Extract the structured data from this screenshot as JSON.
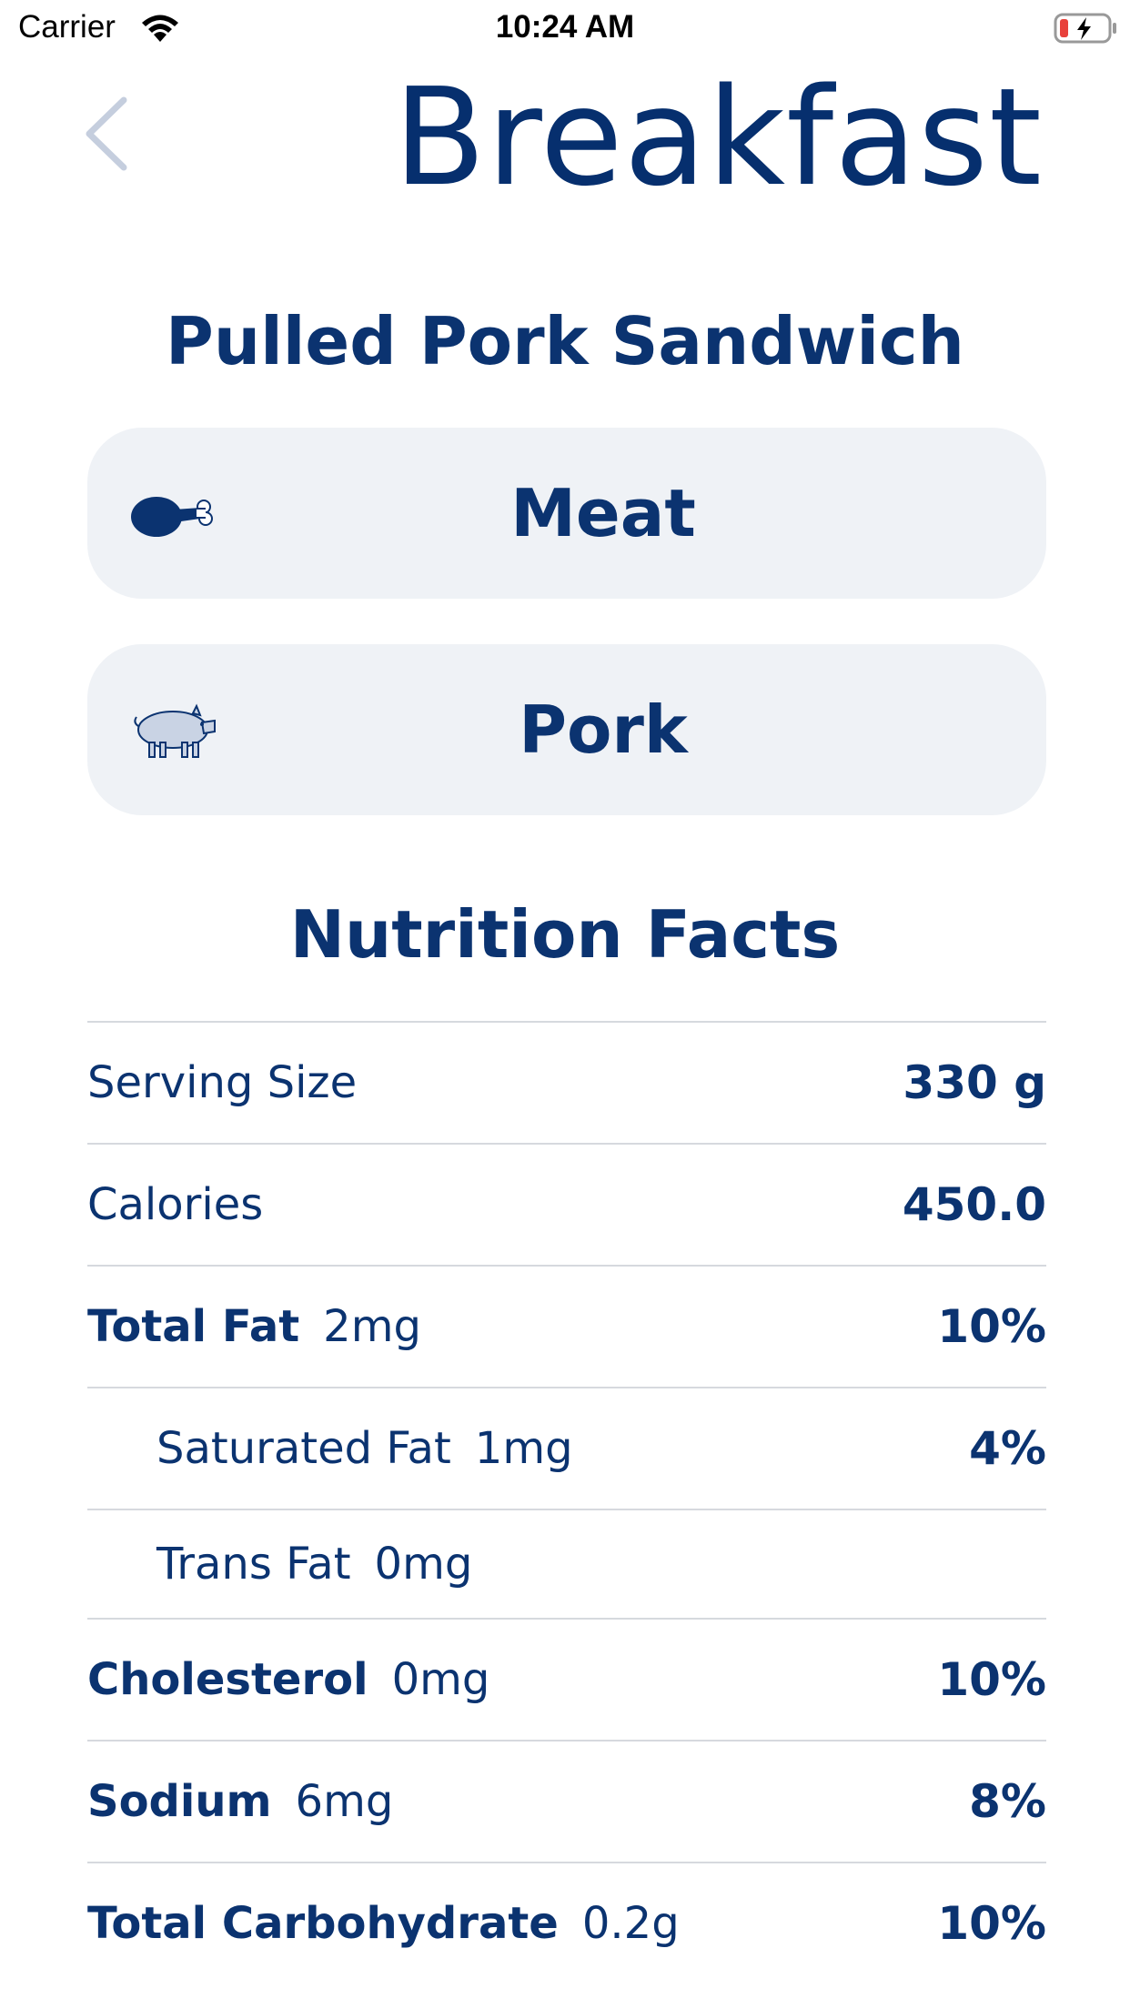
{
  "status_bar": {
    "carrier": "Carrier",
    "time": "10:24 AM"
  },
  "header": {
    "title": "Breakfast"
  },
  "item": {
    "name": "Pulled Pork Sandwich",
    "category": "Meat",
    "subcategory": "Pork"
  },
  "nutrition": {
    "title": "Nutrition Facts",
    "serving_size": {
      "label": "Serving Size",
      "value": "330 g"
    },
    "calories": {
      "label": "Calories",
      "value": "450.0"
    },
    "total_fat": {
      "label": "Total Fat",
      "amount": "2mg",
      "percent": "10%"
    },
    "saturated_fat": {
      "label": "Saturated Fat",
      "amount": "1mg",
      "percent": "4%"
    },
    "trans_fat": {
      "label": "Trans Fat",
      "amount": "0mg"
    },
    "cholesterol": {
      "label": "Cholesterol",
      "amount": "0mg",
      "percent": "10%"
    },
    "sodium": {
      "label": "Sodium",
      "amount": "6mg",
      "percent": "8%"
    },
    "total_carbohydrate": {
      "label": "Total Carbohydrate",
      "amount": "0.2g",
      "percent": "10%"
    }
  },
  "icons": {
    "back": "chevron-left-icon",
    "meat": "drumstick-icon",
    "pork": "pig-icon",
    "wifi": "wifi-icon",
    "battery": "battery-charging-icon"
  },
  "colors": {
    "primary": "#0b3370",
    "card_background": "#eff2f6",
    "divider": "#d6d9de",
    "back_chevron": "#c5cede",
    "pig_fill": "#c9d3e4",
    "battery_low": "#e8413b"
  }
}
